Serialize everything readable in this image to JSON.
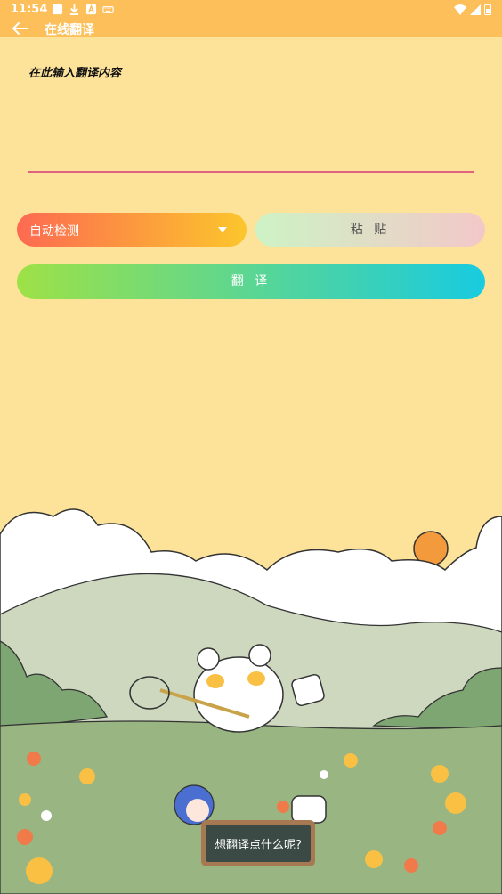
{
  "status_bar": {
    "time": "11:54",
    "left_icons": [
      "gallery-icon",
      "download-icon",
      "a-icon",
      "keyboard-icon"
    ],
    "right_icons": [
      "wifi-icon",
      "signal-icon",
      "battery-icon"
    ]
  },
  "app_bar": {
    "title": "在线翻译",
    "background_color": "#fcbf5a"
  },
  "input": {
    "placeholder": "在此输入翻译内容",
    "value": ""
  },
  "language_select": {
    "selected": "自动检测"
  },
  "paste_button": {
    "label": "粘 贴"
  },
  "translate_button": {
    "label": "翻 译"
  },
  "sign": {
    "text": "想翻译点什么呢?"
  },
  "colors": {
    "page_background": "#fde39a",
    "accent": "#fcbf5a",
    "underline": "#e0627e"
  }
}
